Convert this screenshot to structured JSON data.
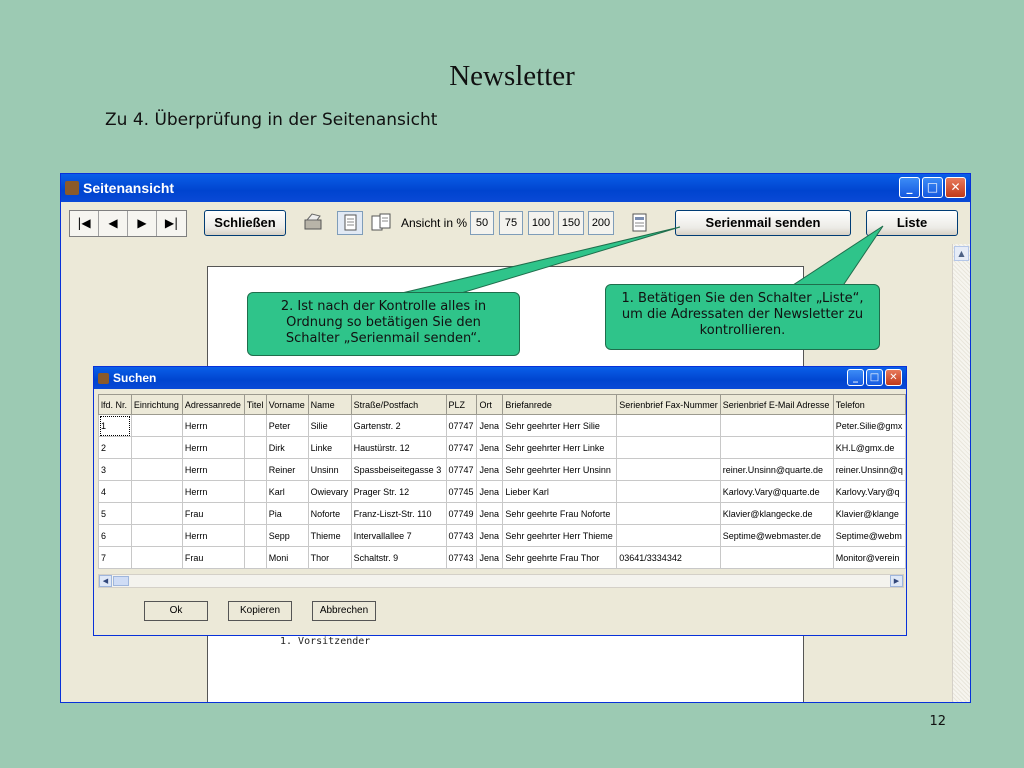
{
  "slide": {
    "title": "Newsletter",
    "subtitle": "Zu 4. Überprüfung in der Seitenansicht",
    "page_number": "12"
  },
  "window": {
    "title": "Seitenansicht",
    "toolbar": {
      "nav": [
        "first-record-icon",
        "prev-record-icon",
        "next-record-icon",
        "last-record-icon"
      ],
      "close_label": "Schließen",
      "zoom_label": "Ansicht in %",
      "zoom_options": [
        "50",
        "75",
        "100",
        "150",
        "200"
      ],
      "serienmail_label": "Serienmail senden",
      "liste_label": "Liste"
    },
    "page_text": "1. Vorsitzender"
  },
  "callouts": {
    "left": "2. Ist nach der Kontrolle alles in Ordnung so betätigen Sie den Schalter „Serienmail senden“.",
    "right": "1. Betätigen Sie den Schalter „Liste“, um die Adressaten der Newsletter zu kontrollieren."
  },
  "dialog": {
    "title": "Suchen",
    "columns": [
      "lfd. Nr.",
      "Einrichtung",
      "Adressanrede",
      "Titel",
      "Vorname",
      "Name",
      "Straße/Postfach",
      "PLZ",
      "Ort",
      "Briefanrede",
      "Serienbrief Fax-Nummer",
      "Serienbrief E-Mail Adresse",
      "Telefon"
    ],
    "rows": [
      [
        "1",
        "",
        "Herrn",
        "",
        "Peter",
        "Silie",
        "Gartenstr.  2",
        "07747",
        "Jena",
        "Sehr geehrter Herr Silie",
        "",
        "",
        "Peter.Silie@gmx"
      ],
      [
        "2",
        "",
        "Herrn",
        "",
        "Dirk",
        "Linke",
        "Haustürstr. 12",
        "07747",
        "Jena",
        "Sehr geehrter Herr Linke",
        "",
        "",
        "KH.L@gmx.de"
      ],
      [
        "3",
        "",
        "Herrn",
        "",
        "Reiner",
        "Unsinn",
        "Spassbeiseitegasse 3",
        "07747",
        "Jena",
        "Sehr geehrter Herr Unsinn",
        "",
        "reiner.Unsinn@quarte.de",
        "reiner.Unsinn@q"
      ],
      [
        "4",
        "",
        "Herrn",
        "",
        "Karl",
        "Owievary",
        "Prager Str. 12",
        "07745",
        "Jena",
        "Lieber Karl",
        "",
        "Karlovy.Vary@quarte.de",
        "Karlovy.Vary@q"
      ],
      [
        "5",
        "",
        "Frau",
        "",
        "Pia",
        "Noforte",
        "Franz-Liszt-Str. 110",
        "07749",
        "Jena",
        "Sehr geehrte Frau Noforte",
        "",
        "Klavier@klangecke.de",
        "Klavier@klange"
      ],
      [
        "6",
        "",
        "Herrn",
        "",
        "Sepp",
        "Thieme",
        "Intervallallee 7",
        "07743",
        "Jena",
        "Sehr geehrter Herr Thieme",
        "",
        "Septime@webmaster.de",
        "Septime@webm"
      ],
      [
        "7",
        "",
        "Frau",
        "",
        "Moni",
        "Thor",
        "Schaltstr. 9",
        "07743",
        "Jena",
        "Sehr geehrte Frau Thor",
        "03641/3334342",
        "",
        "Monitor@verein"
      ]
    ],
    "buttons": {
      "ok": "Ok",
      "copy": "Kopieren",
      "cancel": "Abbrechen"
    }
  },
  "colors": {
    "slide_background": "#9ccab3",
    "callout": "#2fc48a",
    "xp_titlebar": "#0a5fe8"
  }
}
